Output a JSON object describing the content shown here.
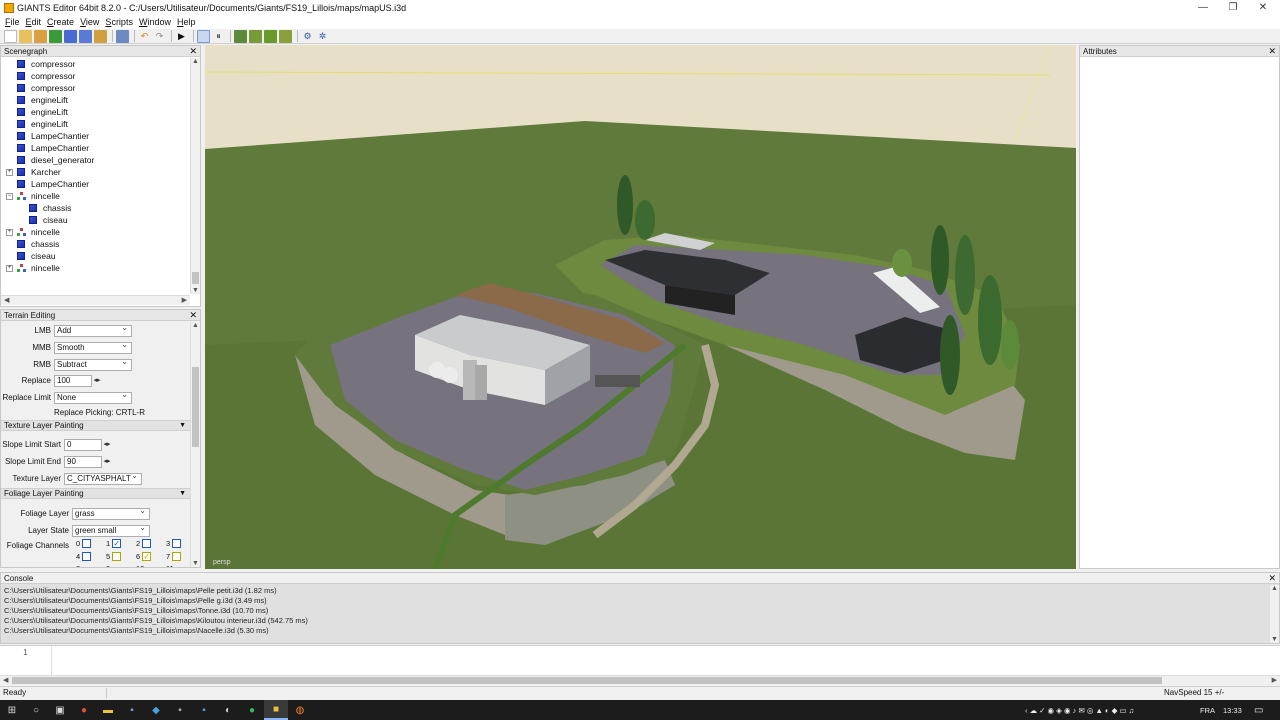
{
  "window": {
    "title": "GIANTS Editor 64bit 8.2.0 - C:/Users/Utilisateur/Documents/Giants/FS19_Lillois/maps/mapUS.i3d",
    "minimize": "—",
    "maximize": "❐",
    "close": "✕"
  },
  "menu": [
    "File",
    "Edit",
    "Create",
    "View",
    "Scripts",
    "Window",
    "Help"
  ],
  "scenegraph": {
    "title": "Scenegraph",
    "close": "✕",
    "items": [
      {
        "label": "compressor",
        "icon": "cube",
        "depth": 0,
        "expander": ""
      },
      {
        "label": "compressor",
        "icon": "cube",
        "depth": 0,
        "expander": ""
      },
      {
        "label": "compressor",
        "icon": "cube",
        "depth": 0,
        "expander": ""
      },
      {
        "label": "engineLift",
        "icon": "cube",
        "depth": 0,
        "expander": ""
      },
      {
        "label": "engineLift",
        "icon": "cube",
        "depth": 0,
        "expander": ""
      },
      {
        "label": "engineLift",
        "icon": "cube",
        "depth": 0,
        "expander": ""
      },
      {
        "label": "LampeChantier",
        "icon": "cube",
        "depth": 0,
        "expander": ""
      },
      {
        "label": "LampeChantier",
        "icon": "cube",
        "depth": 0,
        "expander": ""
      },
      {
        "label": "diesel_generator",
        "icon": "cube",
        "depth": 0,
        "expander": ""
      },
      {
        "label": "Karcher",
        "icon": "cube",
        "depth": 0,
        "expander": "+"
      },
      {
        "label": "LampeChantier",
        "icon": "cube",
        "depth": 0,
        "expander": ""
      },
      {
        "label": "nincelle",
        "icon": "transform-group",
        "depth": 0,
        "expander": "−"
      },
      {
        "label": "chassis",
        "icon": "cube",
        "depth": 1,
        "expander": ""
      },
      {
        "label": "ciseau",
        "icon": "cube",
        "depth": 1,
        "expander": ""
      },
      {
        "label": "nincelle",
        "icon": "transform-group",
        "depth": 0,
        "expander": "+"
      },
      {
        "label": "chassis",
        "icon": "cube",
        "depth": 0,
        "expander": ""
      },
      {
        "label": "ciseau",
        "icon": "cube",
        "depth": 0,
        "expander": ""
      },
      {
        "label": "nincelle",
        "icon": "transform-group",
        "depth": 0,
        "expander": "+"
      }
    ]
  },
  "terrain": {
    "title": "Terrain Editing",
    "close": "✕",
    "lmb_label": "LMB",
    "lmb_value": "Add",
    "mmb_label": "MMB",
    "mmb_value": "Smooth",
    "rmb_label": "RMB",
    "rmb_value": "Subtract",
    "replace_label": "Replace",
    "replace_value": "100",
    "replace_limit_label": "Replace Limit",
    "replace_limit_value": "None",
    "replace_picking": "Replace Picking: CRTL-R",
    "texture_section": "Texture Layer Painting",
    "slope_start_label": "Slope Limit Start",
    "slope_start_value": "0",
    "slope_end_label": "Slope Limit End",
    "slope_end_value": "90",
    "texture_layer_label": "Texture Layer",
    "texture_layer_value": "C_CITYASPHALT",
    "foliage_section": "Foliage Layer Painting",
    "foliage_layer_label": "Foliage Layer",
    "foliage_layer_value": "grass",
    "layer_state_label": "Layer State",
    "layer_state_value": "green small",
    "foliage_channels_label": "Foliage Channels",
    "channels_row1": [
      {
        "n": "0",
        "checked": false,
        "color": "blue"
      },
      {
        "n": "1",
        "checked": true,
        "color": "blue"
      },
      {
        "n": "2",
        "checked": false,
        "color": "blue"
      },
      {
        "n": "3",
        "checked": false,
        "color": "blue"
      }
    ],
    "channels_row2": [
      {
        "n": "4",
        "checked": false,
        "color": "blue"
      },
      {
        "n": "5",
        "checked": false,
        "color": "yellow"
      },
      {
        "n": "6",
        "checked": true,
        "color": "yellow"
      },
      {
        "n": "7",
        "checked": false,
        "color": "yellow"
      }
    ],
    "channels_row3_partial": [
      "8",
      "9",
      "10",
      "11"
    ]
  },
  "viewport": {
    "camera_label": "persp",
    "sky_color": "#e8dfc9",
    "grass_color": "#5f7a3a",
    "asphalt_color": "#76727e",
    "cliff_color": "#a09a8c"
  },
  "attributes": {
    "title": "Attributes",
    "close": "✕"
  },
  "console": {
    "title": "Console",
    "close": "✕",
    "lines": [
      "C:\\Users\\Utilisateur\\Documents\\Giants\\FS19_Lillois\\maps\\Pelle petit.i3d (1.82 ms)",
      "C:\\Users\\Utilisateur\\Documents\\Giants\\FS19_Lillois\\maps\\Pelle g.i3d (3.49 ms)",
      "C:\\Users\\Utilisateur\\Documents\\Giants\\FS19_Lillois\\maps\\Tonne.i3d (10.70 ms)",
      "C:\\Users\\Utilisateur\\Documents\\Giants\\FS19_Lillois\\maps\\Kiloutou interieur.i3d (542.75 ms)",
      "C:\\Users\\Utilisateur\\Documents\\Giants\\FS19_Lillois\\maps\\Nacelle.i3d (5.30 ms)"
    ],
    "script_line": "1"
  },
  "status": {
    "left": "Ready",
    "right": "NavSpeed 15 +/-"
  },
  "taskbar": {
    "language": "FRA",
    "time": "13:33"
  }
}
